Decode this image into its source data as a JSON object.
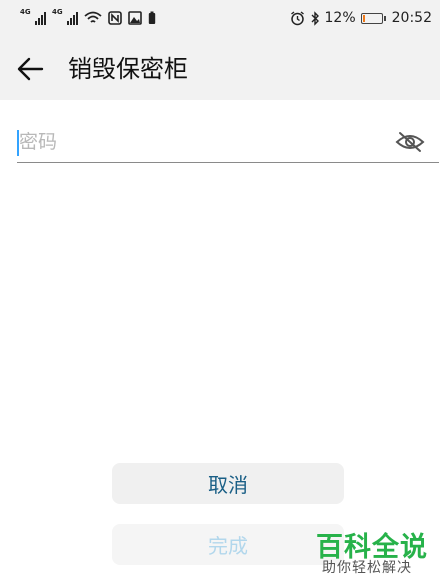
{
  "status_bar": {
    "net1": "4G",
    "net2": "4G",
    "battery_percent": "12%",
    "battery_level": 0.12,
    "time": "20:52"
  },
  "header": {
    "title": "销毁保密柜"
  },
  "password": {
    "value": "",
    "placeholder": "密码"
  },
  "buttons": {
    "cancel_label": "取消",
    "done_label": "完成"
  },
  "watermark": {
    "title": "百科全说",
    "subtitle": "助你轻松解决"
  },
  "colors": {
    "accent": "#33a3ff",
    "cancel_text": "#1a5f86",
    "done_text_disabled": "#b2d7ec",
    "battery_low": "#f07a1a",
    "watermark_green": "#27b24a"
  },
  "icons": [
    "back-arrow-icon",
    "eye-off-icon",
    "alarm-icon",
    "bluetooth-icon",
    "wifi-icon",
    "nfc-icon",
    "image-icon",
    "battery-icon"
  ]
}
